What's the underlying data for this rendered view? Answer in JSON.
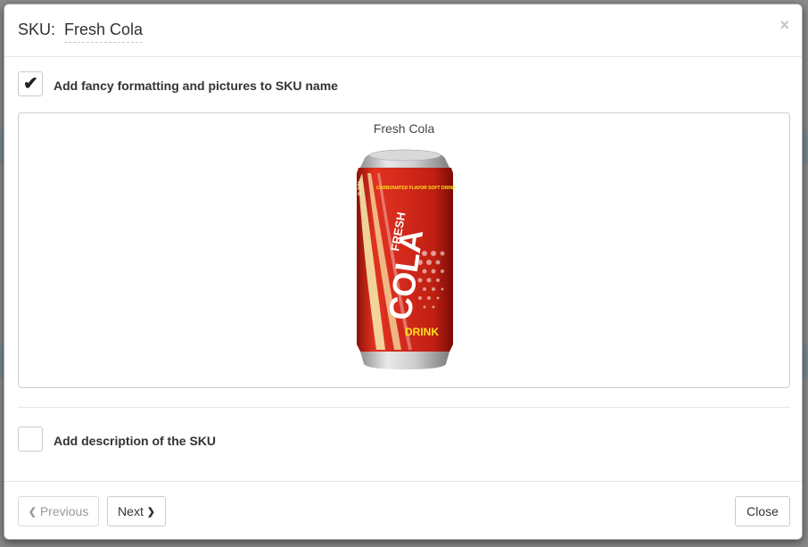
{
  "dialog": {
    "title_label": "SKU:",
    "title_value": "Fresh Cola",
    "close_symbol": "×"
  },
  "options": {
    "fancy_formatting": {
      "label": "Add fancy formatting and pictures to SKU name",
      "checked": true,
      "check_glyph": "✔"
    },
    "description": {
      "label": "Add description of the SKU",
      "checked": false
    }
  },
  "preview": {
    "title": "Fresh Cola",
    "image_icon": "cola-can-image",
    "can_text": {
      "volume": "0.33L",
      "tagline": "CARBONATED FLAVOR SOFT DRINK",
      "brand_small": "FRESH",
      "brand_large": "COLA",
      "sub": "DRINK"
    },
    "colors": {
      "can_red": "#d42a1c",
      "can_accent": "#f5e6a8",
      "drink_yellow": "#ffe61a"
    }
  },
  "footer": {
    "previous_label": "Previous",
    "next_label": "Next",
    "close_label": "Close",
    "prev_icon": "chevron-left-icon",
    "next_icon": "chevron-right-icon"
  }
}
